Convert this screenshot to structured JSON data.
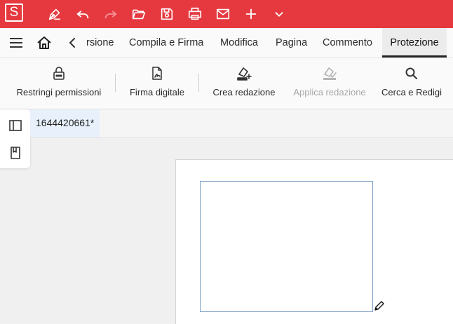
{
  "app": {
    "logo_letter": "S"
  },
  "titlebar": {
    "icons": [
      "pen-tool-icon",
      "undo-icon",
      "redo-icon",
      "open-folder-icon",
      "save-icon",
      "print-icon",
      "mail-icon",
      "add-icon",
      "chevron-down-icon"
    ]
  },
  "menubar": {
    "items": [
      {
        "label": "rsione"
      },
      {
        "label": "Compila e Firma"
      },
      {
        "label": "Modifica"
      },
      {
        "label": "Pagina"
      },
      {
        "label": "Commento"
      },
      {
        "label": "Protezione",
        "active": true
      }
    ]
  },
  "ribbon": {
    "buttons": [
      {
        "label": "Restringi permissioni",
        "icon": "lock-icon"
      },
      {
        "label": "Firma digitale",
        "icon": "digital-signature-icon"
      },
      {
        "label": "Crea redazione",
        "icon": "create-redaction-icon"
      },
      {
        "label": "Applica redazione",
        "icon": "apply-redaction-icon",
        "disabled": true
      },
      {
        "label": "Cerca e Redigi",
        "icon": "search-icon"
      }
    ]
  },
  "doc_tabs": [
    {
      "label": "1644420661*"
    }
  ],
  "colors": {
    "titlebar": "#e5393f",
    "active_tab_bg": "#e8f1fb",
    "signature_box_border": "#7da0c4"
  }
}
